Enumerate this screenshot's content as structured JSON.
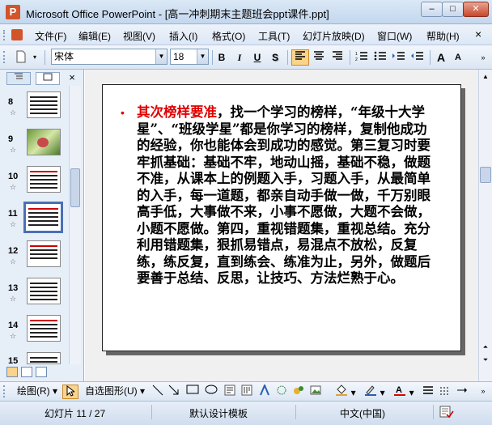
{
  "window": {
    "app_icon": "P",
    "title": "Microsoft Office PowerPoint - [高一冲刺期末主题班会ppt课件.ppt]",
    "minimize_label": "–",
    "maximize_label": "□",
    "close_label": "✕"
  },
  "menu": {
    "items": [
      "文件(F)",
      "编辑(E)",
      "视图(V)",
      "插入(I)",
      "格式(O)",
      "工具(T)",
      "幻灯片放映(D)",
      "窗口(W)",
      "帮助(H)"
    ],
    "doc_close": "×"
  },
  "toolbar": {
    "font_name": "宋体",
    "font_size": "18",
    "bold": "B",
    "italic": "I",
    "underline": "U",
    "shadow": "S",
    "grow_font": "A",
    "shrink_font": "A"
  },
  "panel": {
    "tab_outline_icon": "outline-icon",
    "tab_slides_icon": "slides-icon",
    "close": "×",
    "slides": [
      {
        "num": "8",
        "selected": false,
        "kind": "text"
      },
      {
        "num": "9",
        "selected": false,
        "kind": "photo"
      },
      {
        "num": "10",
        "selected": false,
        "kind": "text"
      },
      {
        "num": "11",
        "selected": true,
        "kind": "text"
      },
      {
        "num": "12",
        "selected": false,
        "kind": "text"
      },
      {
        "num": "13",
        "selected": false,
        "kind": "text"
      },
      {
        "num": "14",
        "selected": false,
        "kind": "text"
      },
      {
        "num": "15",
        "selected": false,
        "kind": "text"
      }
    ],
    "star": "☆"
  },
  "slide": {
    "bullet": "•",
    "highlight": "其次榜样要准",
    "body": "，找一个学习的榜样，“年级十大学星”、“班级学星”都是你学习的榜样，复制他成功的经验，你也能体会到成功的感觉。第三复习时要牢抓基础：基础不牢，地动山摇，基础不稳，做题不准，从课本上的例题入手，习题入手，从最简单的入手，每一道题，都亲自动手做一做，千万别眼高手低，大事做不来，小事不愿做，大题不会做，小题不愿做。第四，重视错题集，重视总结。充分利用错题集，狠抓易错点，易混点不放松，反复练，练反复，直到练会、练准为止，另外，做题后要善于总结、反思，让技巧、方法烂熟于心。"
  },
  "drawbar": {
    "draw_label": "绘图(R)",
    "autoshape_label": "自选图形(U)"
  },
  "status": {
    "slide_info": "幻灯片 11 / 27",
    "template": "默认设计模板",
    "language": "中文(中国)"
  },
  "colors": {
    "highlight": "#e00000",
    "selected_thumb_border": "#4a6fb3"
  }
}
